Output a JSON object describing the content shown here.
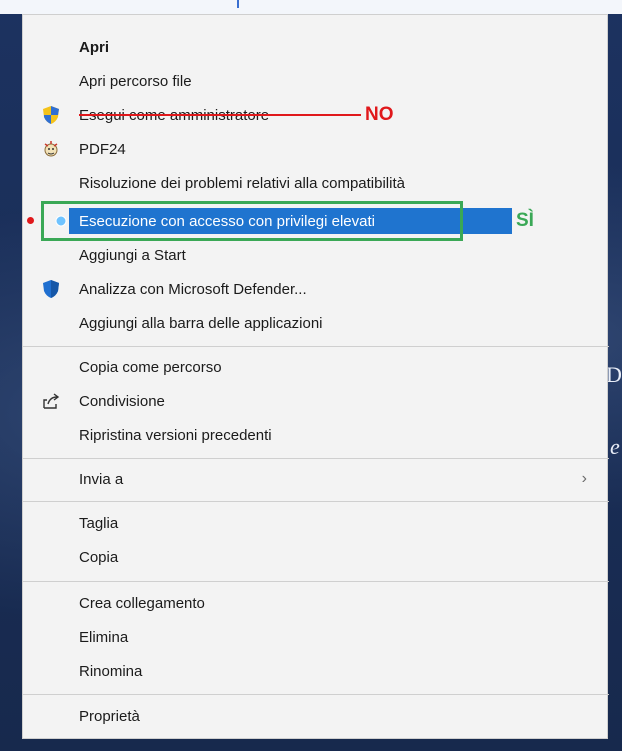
{
  "menu": {
    "group1": {
      "open": "Apri",
      "open_file_location": "Apri percorso file",
      "run_as_admin": "Esegui come amministratore",
      "pdf24": "PDF24",
      "troubleshoot": "Risoluzione dei problemi relativi alla compatibilità",
      "run_elevated": "Esecuzione con accesso con privilegi elevati",
      "pin_start": "Aggiungi a Start",
      "defender_scan": "Analizza con Microsoft Defender...",
      "pin_taskbar": "Aggiungi alla barra delle applicazioni"
    },
    "group2": {
      "copy_as_path": "Copia come percorso",
      "share": "Condivisione",
      "restore_versions": "Ripristina versioni precedenti"
    },
    "group3": {
      "send_to": "Invia a"
    },
    "group4": {
      "cut": "Taglia",
      "copy": "Copia"
    },
    "group5": {
      "create_shortcut": "Crea collegamento",
      "delete": "Elimina",
      "rename": "Rinomina"
    },
    "group6": {
      "properties": "Proprietà"
    }
  },
  "annotations": {
    "no_label": "NO",
    "yes_label": "SÌ",
    "colors": {
      "red": "#e0181b",
      "green": "#3aa856",
      "highlight_blue": "#1f74cf"
    }
  },
  "icons": {
    "run_as_admin": "uac-shield-icon",
    "pdf24": "pdf24-icon",
    "run_elevated": "elevated-dot-icon",
    "defender_scan": "defender-shield-icon",
    "share": "share-icon",
    "send_to_chevron": "chevron-right-icon"
  },
  "background": {
    "glyph_right_top": "D",
    "glyph_right_mid": "e"
  }
}
